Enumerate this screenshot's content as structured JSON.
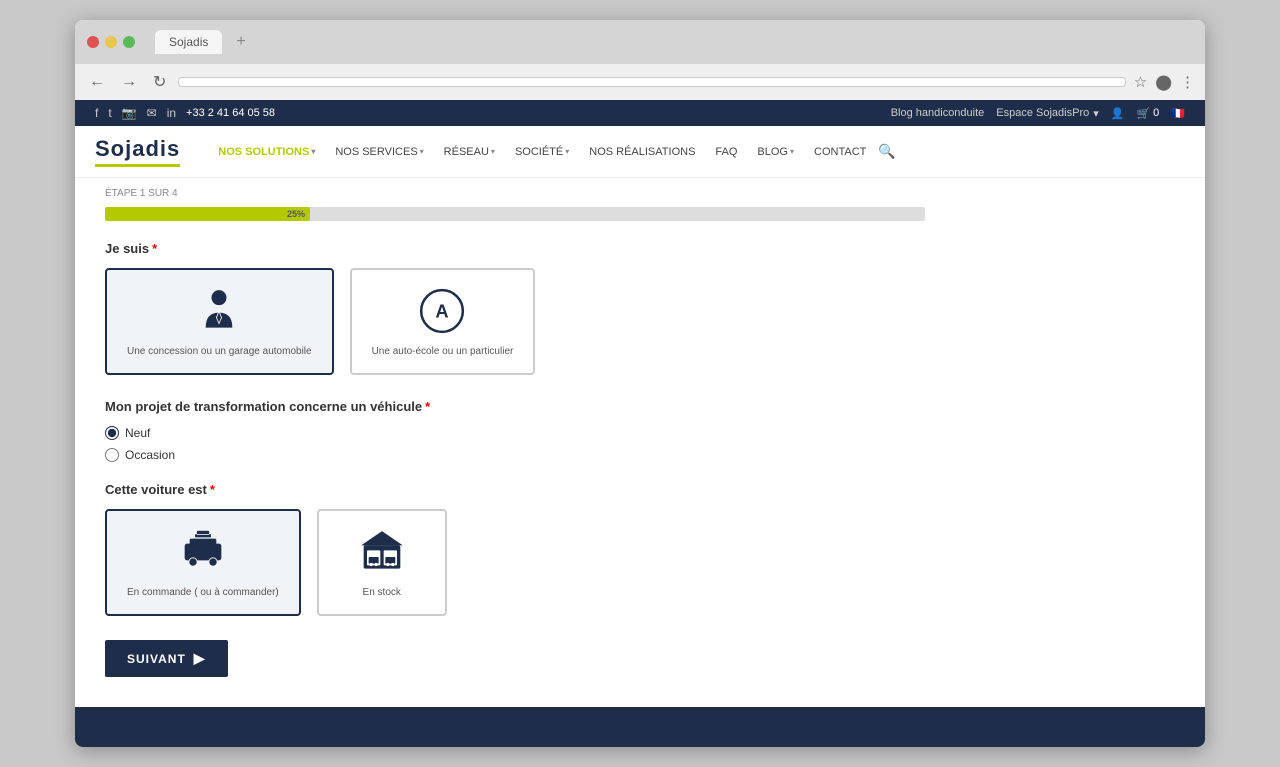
{
  "browser": {
    "tab_label": "Sojadis",
    "tab_plus": "+",
    "back_icon": "←",
    "forward_icon": "→",
    "refresh_icon": "↻",
    "star_icon": "☆",
    "menu_icon": "⋮"
  },
  "topbar": {
    "phone": "+33 2 41 64 05 58",
    "blog_link": "Blog handiconduite",
    "espace_pro": "Espace SojadisPro",
    "cart_count": "0"
  },
  "nav": {
    "logo": "Sojadis",
    "items": [
      {
        "label": "NOS SOLUTIONS",
        "has_dropdown": true,
        "active": true
      },
      {
        "label": "NOS SERVICES",
        "has_dropdown": true,
        "active": false
      },
      {
        "label": "RÉSEAU",
        "has_dropdown": true,
        "active": false
      },
      {
        "label": "SOCIÉTÉ",
        "has_dropdown": true,
        "active": false
      },
      {
        "label": "NOS RÉALISATIONS",
        "has_dropdown": false,
        "active": false
      },
      {
        "label": "FAQ",
        "has_dropdown": false,
        "active": false
      },
      {
        "label": "BLOG",
        "has_dropdown": true,
        "active": false
      },
      {
        "label": "CONTACT",
        "has_dropdown": false,
        "active": false
      }
    ]
  },
  "breadcrumb": {
    "text": "ÉTAPE 1 SUR 4"
  },
  "progress": {
    "percent": 25,
    "label": "25%"
  },
  "form": {
    "je_suis_label": "Je suis",
    "je_suis_required": "*",
    "option1_label": "Une concession ou un garage automobile",
    "option2_label": "Une auto-école ou un particulier",
    "projet_label": "Mon projet de transformation concerne un véhicule",
    "projet_required": "*",
    "radio_options": [
      {
        "label": "Neuf",
        "value": "neuf",
        "checked": true
      },
      {
        "label": "Occasion",
        "value": "occasion",
        "checked": false
      }
    ],
    "voiture_label": "Cette voiture est",
    "voiture_required": "*",
    "voiture_option1": "En commande ( ou à commander)",
    "voiture_option2": "En stock",
    "suivant_label": "SUIVANT"
  }
}
